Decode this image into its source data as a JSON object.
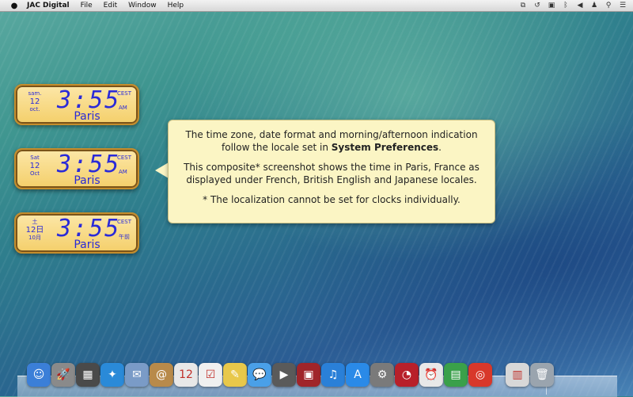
{
  "menubar": {
    "app_name": "JAC Digital",
    "menus": [
      "File",
      "Edit",
      "Window",
      "Help"
    ],
    "status_icons": [
      "translate-icon",
      "time-machine-icon",
      "display-icon",
      "bluetooth-icon",
      "volume-icon",
      "user-icon",
      "spotlight-icon",
      "notification-center-icon"
    ]
  },
  "clocks": [
    {
      "weekday": "sam.",
      "day": "12",
      "month": "oct.",
      "time": "3:55",
      "timezone": "CEST",
      "ampm": "AM",
      "city": "Paris"
    },
    {
      "weekday": "Sat",
      "day": "12",
      "month": "Oct",
      "time": "3:55",
      "timezone": "CEST",
      "ampm": "AM",
      "city": "Paris"
    },
    {
      "weekday": "土",
      "day": "12日",
      "month": "10月",
      "time": "3:55",
      "timezone": "CEST",
      "ampm": "午前",
      "city": "Paris"
    }
  ],
  "callout": {
    "line1_prefix": "The time zone, date format and morning/afternoon indication follow the locale set in ",
    "line1_bold": "System Preferences",
    "line1_suffix": ".",
    "line2": "This composite* screenshot shows the time in Paris, France as displayed under French, British English and Japanese locales.",
    "line3": "* The localization cannot be set for clocks individually."
  },
  "dock": {
    "apps": [
      {
        "name": "finder-icon",
        "glyph": "☺",
        "color": "#3b7fd8"
      },
      {
        "name": "launchpad-icon",
        "glyph": "🚀",
        "color": "#8a8a8a"
      },
      {
        "name": "mission-control-icon",
        "glyph": "▦",
        "color": "#4a4a4a"
      },
      {
        "name": "safari-icon",
        "glyph": "✦",
        "color": "#2a8ad8"
      },
      {
        "name": "mail-icon",
        "glyph": "✉",
        "color": "#7a9bc7"
      },
      {
        "name": "contacts-icon",
        "glyph": "@",
        "color": "#b88a4a"
      },
      {
        "name": "calendar-icon",
        "glyph": "12",
        "color": "#e8e8e8"
      },
      {
        "name": "reminders-icon",
        "glyph": "☑",
        "color": "#f0f0f0"
      },
      {
        "name": "notes-icon",
        "glyph": "✎",
        "color": "#e8c84a"
      },
      {
        "name": "messages-icon",
        "glyph": "💬",
        "color": "#4aa0e8"
      },
      {
        "name": "facetime-icon",
        "glyph": "▶",
        "color": "#5a5a5a"
      },
      {
        "name": "photo-booth-icon",
        "glyph": "▣",
        "color": "#a0252a"
      },
      {
        "name": "itunes-icon",
        "glyph": "♫",
        "color": "#2a80d8"
      },
      {
        "name": "app-store-icon",
        "glyph": "A",
        "color": "#2a8ae8"
      },
      {
        "name": "system-preferences-icon",
        "glyph": "⚙",
        "color": "#7a7a7a"
      },
      {
        "name": "jac-digital-icon",
        "glyph": "◔",
        "color": "#b8202a"
      },
      {
        "name": "clock-app-icon",
        "glyph": "⏰",
        "color": "#e8e8e8"
      },
      {
        "name": "stickies-app-icon",
        "glyph": "▤",
        "color": "#3aa04a"
      },
      {
        "name": "help-lifebuoy-icon",
        "glyph": "◎",
        "color": "#d8382a"
      },
      {
        "name": "documents-folder-icon",
        "glyph": "▥",
        "color": "#d8d8d8"
      },
      {
        "name": "trash-icon",
        "glyph": "🗑",
        "color": "#9aa4ae"
      }
    ]
  }
}
